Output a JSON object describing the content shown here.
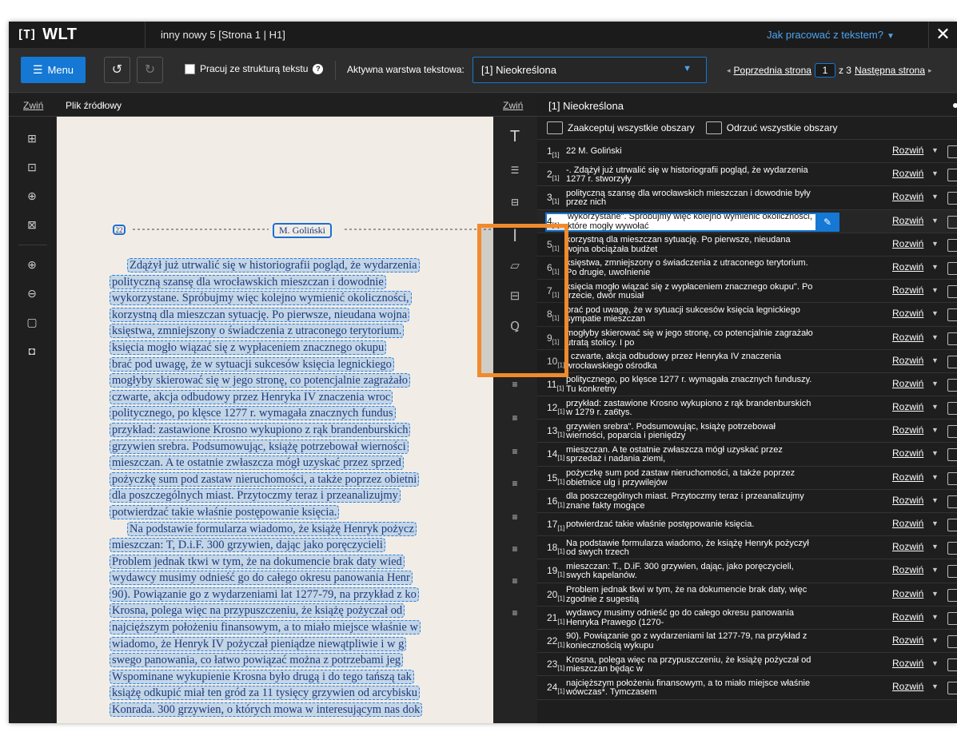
{
  "app": {
    "logo": "WLT",
    "doc_title": "inny nowy 5 [Strona 1 | H1]",
    "help": "Jak pracować z tekstem?",
    "close": "✕"
  },
  "toolbar": {
    "menu": "Menu",
    "structure_label": "Pracuj ze strukturą tekstu",
    "active_layer_label": "Aktywna warstwa tekstowa:",
    "layer_value": "[1] Nieokreślona",
    "prev_page": "Poprzednia strona",
    "page_current": "1",
    "page_of": "z 3",
    "next_page": "Następna strona"
  },
  "left_panel": {
    "collapse": "Zwiń",
    "title": "Plik źródłowy"
  },
  "mid_panel": {
    "collapse": "Zwiń"
  },
  "scan": {
    "page_number": "22",
    "running_head": "M. Goliński",
    "lines": [
      "Zdążył już utrwalić się w historiografii pogląd, że wydarzenia",
      "polityczną szansę dla wrocławskich mieszczan i dowodnie",
      "wykorzystane. Spróbujmy więc kolejno wymienić okoliczności,",
      "korzystną dla mieszczan sytuację. Po pierwsze, nieudana wojna",
      "księstwa, zmniejszony o świadczenia z utraconego terytorium.",
      "księcia mogło wiązać się z wypłaceniem znacznego okupu",
      "brać pod uwagę, że w sytuacji sukcesów księcia legnickiego",
      "mogłyby skierować się w jego stronę, co potencjalnie zagrażało",
      "czwarte, akcja odbudowy przez Henryka IV znaczenia wroc",
      "politycznego, po klęsce 1277 r. wymagała znacznych fundus",
      "przykład: zastawione Krosno wykupiono z rąk brandenburskich",
      "grzywien srebra. Podsumowując, książę potrzebował wierności",
      "mieszczan. A te ostatnie zwłaszcza mógł uzyskać przez sprzed",
      "pożyczkę sum pod zastaw nieruchomości, a także poprzez obietni",
      "dla poszczególnych miast. Przytoczmy teraz i przeanalizujmy",
      "potwierdzać takie właśnie postępowanie księcia.",
      "Na podstawie formularza wiadomo, że książę Henryk pożycz",
      "mieszczan: T, D.i.F. 300 grzywien, dając jako poręczycieli",
      "Problem jednak tkwi w tym, że na dokumencie brak daty wied",
      "wydawcy musimy odnieść go do całego okresu panowania Henr",
      "90). Powiązanie go z wydarzeniami lat 1277-79, na przykład z ko",
      "Krosna, polega więc na przypuszczeniu, że książę pożyczał od",
      "najcięższym położeniu finansowym, a to miało miejsce właśnie w",
      "wiadomo, że Henryk IV pożyczał pieniądze niewątpliwie i w g",
      "swego panowania, co łatwo powiązać można z potrzebami jeg",
      "Wspominane wykupienie Krosna było drugą i do tego tańszą tak",
      "książę odkupić miał ten gród za 11 tysięcy grzywien od arcybisku",
      "Konrada. 300 grzywien, o których mowa w interesującym nas dok"
    ]
  },
  "right_panel": {
    "title": "[1] Nieokreślona",
    "accept_all": "Zaakceptuj wszystkie obszary",
    "reject_all": "Odrzuć wszystkie obszary",
    "expand_label": "Rozwiń",
    "layer_tag": "[1]",
    "rows": [
      {
        "n": "1",
        "text": "22 M. Goliński"
      },
      {
        "n": "2",
        "text": "-. Zdążył już utrwalić się w historiografii pogląd, że wydarzenia 1277 r. stworzyły"
      },
      {
        "n": "3",
        "text": "polityczną szansę dla wrocławskich mieszczan i dowodnie były przez nich"
      },
      {
        "n": "4",
        "text": "wykorzystane\". Spróbujmy więc kolejno wymienić okoliczności, które mogły wywołać"
      },
      {
        "n": "5",
        "text": "korzystną dla mieszczan sytuację. Po pierwsze, nieudana wojna obciążała budżet"
      },
      {
        "n": "6",
        "text": "księstwa, zmniejszony o świadczenia z utraconego terytorium. Po drugie, uwolnienie"
      },
      {
        "n": "7",
        "text": "księcia mogło wiązać się z wypłaceniem znacznego okupu\". Po trzecie, dwór musiał"
      },
      {
        "n": "8",
        "text": "brać pod uwagę, że w sytuacji sukcesów księcia legnickiego sympatie mieszczan"
      },
      {
        "n": "9",
        "text": "mogłyby skierować się w jego stronę, co potencjalnie zagrażało utratą stolicy. I po"
      },
      {
        "n": "10",
        "text": "| czwarte, akcja odbudowy przez Henryka IV znaczenia wrocławskiego ośrodka"
      },
      {
        "n": "11",
        "text": "politycznego, po klęsce 1277 r. wymagała znacznych funduszy. Tu konkretny"
      },
      {
        "n": "12",
        "text": "przykład: zastawione Krosno wykupiono z rąk brandenburskich w 1279 r. za6tys."
      },
      {
        "n": "13",
        "text": "grzywien srebra\". Podsumowując, książę potrzebował wierności, poparcia i pieniędzy"
      },
      {
        "n": "14",
        "text": "mieszczan. A te ostatnie zwłaszcza mógł uzyskać przez sprzedaż i nadania ziemi,"
      },
      {
        "n": "15",
        "text": "pożyczkę sum pod zastaw nieruchomości, a także poprzez obietnice ulg i przywilejów"
      },
      {
        "n": "16",
        "text": "dla poszczególnych miast. Przytoczmy teraz i przeanalizujmy znane fakty mogące"
      },
      {
        "n": "17",
        "text": "potwierdzać takie właśnie postępowanie księcia."
      },
      {
        "n": "18",
        "text": "Na podstawie formularza wiadomo, że książę Henryk pożyczył od swych trzech"
      },
      {
        "n": "19",
        "text": "mieszczan: T., D.iF. 300 grzywien, dając, jako poręczycieli, swych kapelanów."
      },
      {
        "n": "20",
        "text": "Problem jednak tkwi w tym, że na dokumencie brak daty, więc zgodnie z sugestią"
      },
      {
        "n": "21",
        "text": "wydawcy musimy odnieść go do całego okresu panowania Henryka Prawego (1270-"
      },
      {
        "n": "22",
        "text": "90). Powiązanie go z wydarzeniami lat 1277-79, na przykład z koniecznością wykupu"
      },
      {
        "n": "23",
        "text": "Krosna, polega więc na przypuszczeniu, że książę pożyczał od mieszczan będąc w"
      },
      {
        "n": "24",
        "text": "najcięższym położeniu finansowym, a to miało miejsce właśnie wówczas*. Tymczasem"
      }
    ]
  }
}
